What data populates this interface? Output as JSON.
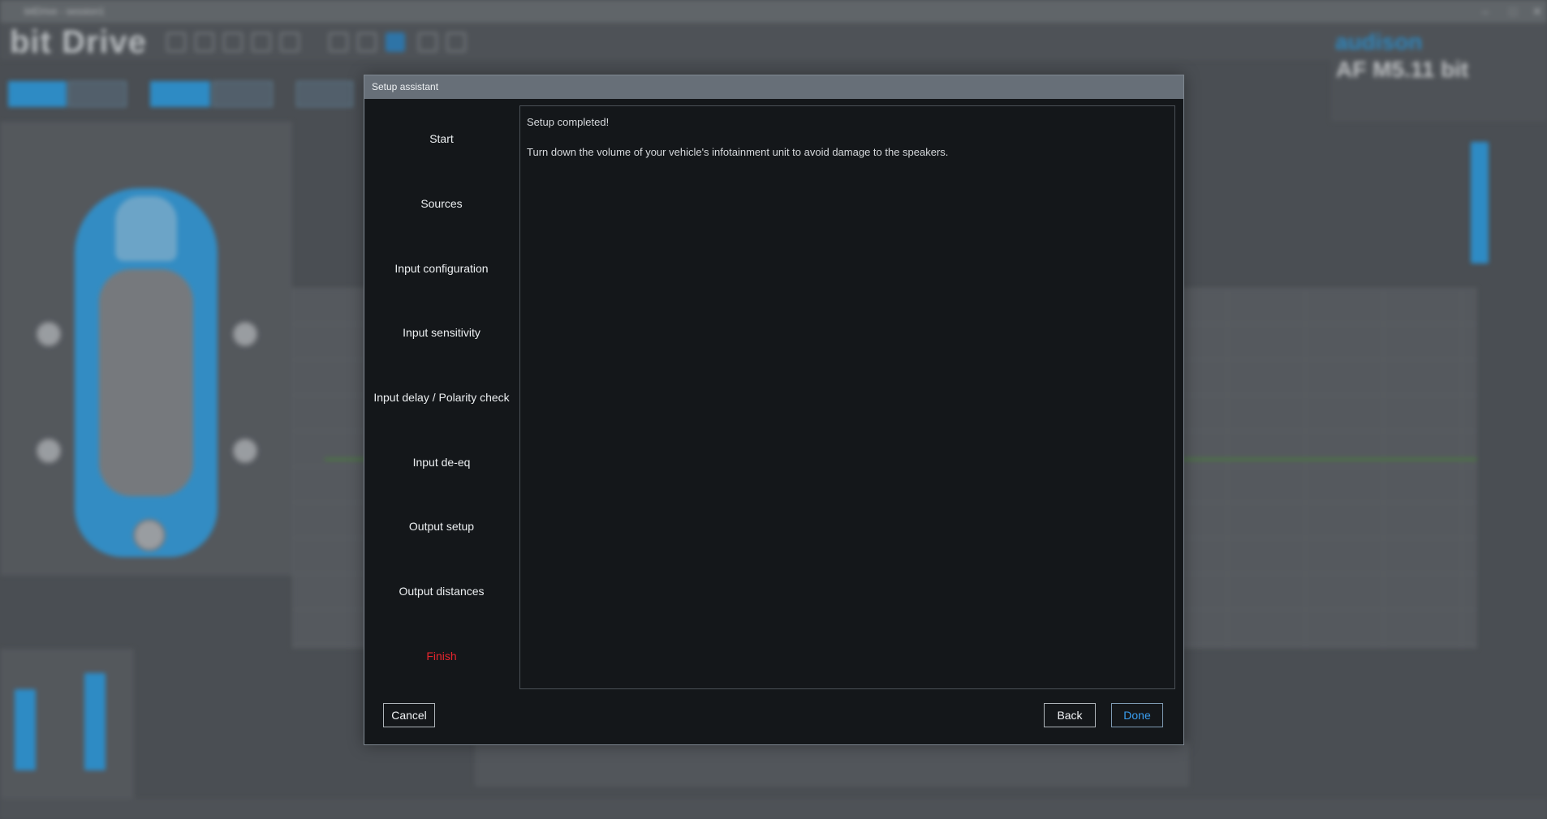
{
  "background": {
    "window_title": "bitDrive - session1",
    "brand": "bit Drive",
    "logo_text": "audison",
    "device_name": "AF M5.11 bit",
    "colors": {
      "accent": "#2aa4ef",
      "background": "#4f5358"
    }
  },
  "dialog": {
    "title": "Setup assistant",
    "steps": [
      {
        "label": "Start"
      },
      {
        "label": "Sources"
      },
      {
        "label": "Input configuration"
      },
      {
        "label": "Input sensitivity"
      },
      {
        "label": "Input delay / Polarity check"
      },
      {
        "label": "Input de-eq"
      },
      {
        "label": "Output setup"
      },
      {
        "label": "Output distances"
      },
      {
        "label": "Finish"
      }
    ],
    "active_step": "Finish",
    "content": {
      "heading": "Setup completed!",
      "message": "Turn down the volume of your vehicle's infotainment unit to avoid damage to the speakers."
    },
    "buttons": {
      "cancel": "Cancel",
      "back": "Back",
      "done": "Done"
    },
    "colors": {
      "active_step": "#e7252d",
      "done_button": "#3a9ef0",
      "panel": "#14171a",
      "titlebar": "#676f78"
    }
  }
}
